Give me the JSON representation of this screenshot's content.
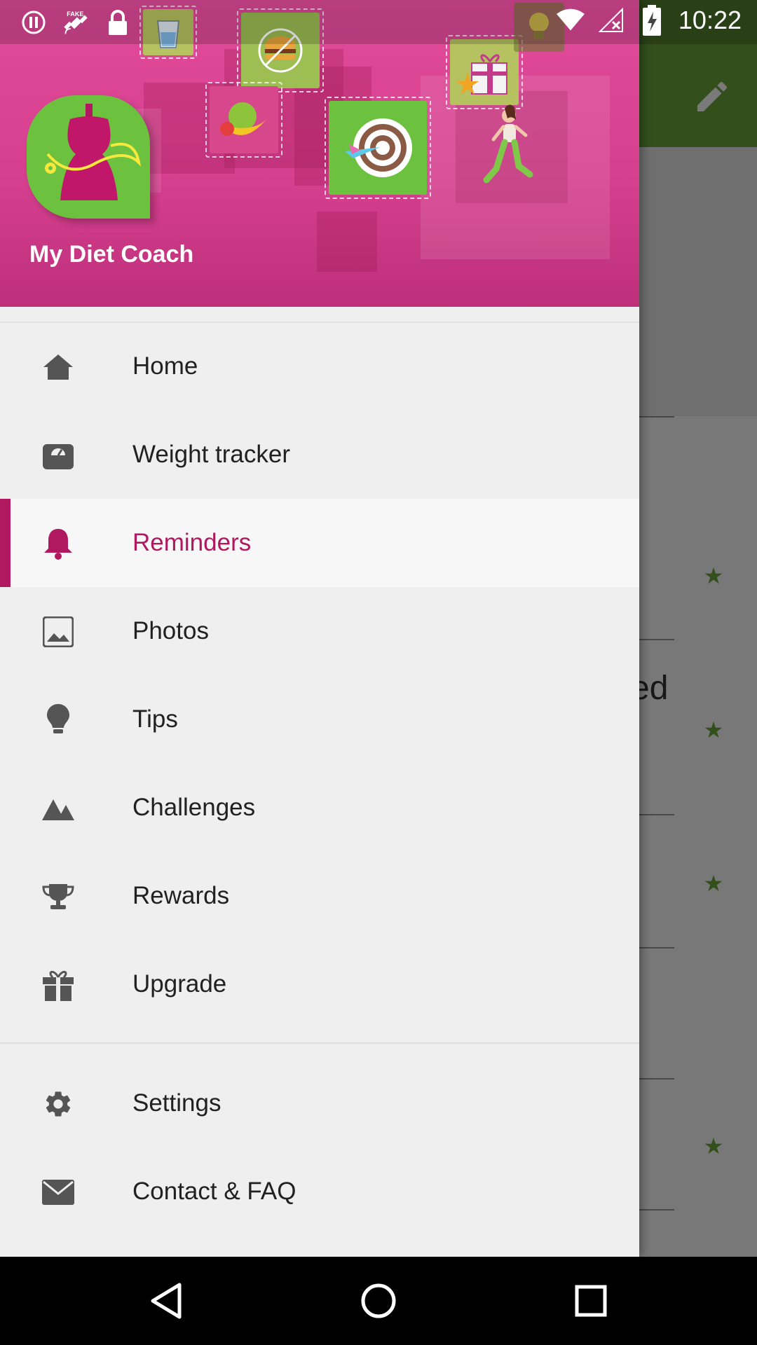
{
  "status_bar": {
    "time": "10:22",
    "icons": [
      "alert-icon",
      "fake-gps-icon",
      "lock-icon",
      "wifi-icon",
      "signal-icon",
      "battery-icon"
    ]
  },
  "drawer": {
    "app_name": "My Diet Coach",
    "primary_items": [
      {
        "label": "Home",
        "icon": "home-icon"
      },
      {
        "label": "Weight tracker",
        "icon": "scale-icon"
      },
      {
        "label": "Reminders",
        "icon": "bell-icon",
        "active": true
      },
      {
        "label": "Photos",
        "icon": "photo-icon"
      },
      {
        "label": "Tips",
        "icon": "lightbulb-icon"
      },
      {
        "label": "Challenges",
        "icon": "mountain-icon"
      },
      {
        "label": "Rewards",
        "icon": "trophy-icon"
      },
      {
        "label": "Upgrade",
        "icon": "gift-icon"
      }
    ],
    "secondary_items": [
      {
        "label": "Settings",
        "icon": "gear-icon"
      },
      {
        "label": "Contact & FAQ",
        "icon": "mail-icon"
      }
    ]
  },
  "background": {
    "partial_text": "ed"
  },
  "colors": {
    "accent": "#b0185f",
    "header_pink": "#d53f8e",
    "brand_green": "#6cc13f",
    "toolbar_green": "#6aa63b"
  }
}
